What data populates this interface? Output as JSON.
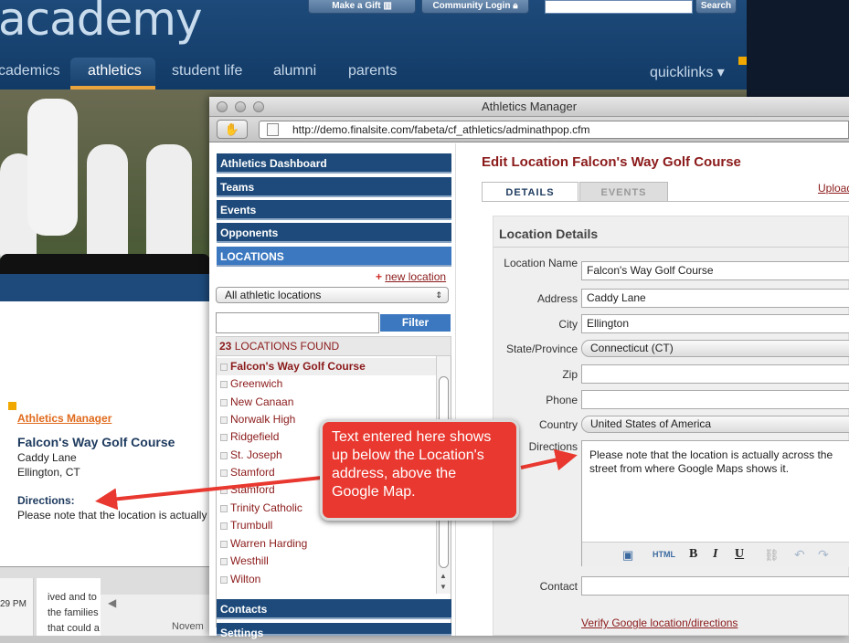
{
  "site": {
    "logo": "academy",
    "top_buttons": [
      "Make a Gift",
      "Community Login",
      "Search"
    ],
    "nav": [
      "cademics",
      "athletics",
      "student life",
      "alumni",
      "parents",
      "quicklinks ▾"
    ],
    "active_nav": "athletics",
    "content": {
      "manager_link": "Athletics Manager",
      "heading": "Falcon's Way Golf Course",
      "address1": "Caddy Lane",
      "address2": "Ellington, CT",
      "directions_label": "Directions:",
      "directions_text": "Please note that the location is actually"
    },
    "lower": {
      "time": "29 PM",
      "line1": "ived and to",
      "line2": "the families",
      "line3": "that could a",
      "month": "Novem"
    }
  },
  "window": {
    "title": "Athletics Manager",
    "url": "http://demo.finalsite.com/fabeta/cf_athletics/adminathpop.cfm"
  },
  "left": {
    "menu": [
      "Athletics Dashboard",
      "Teams",
      "Events",
      "Opponents",
      "LOCATIONS"
    ],
    "new_location": "new location",
    "filter_select": "All athletic locations",
    "filter_button": "Filter",
    "found_count": "23",
    "found_label": "LOCATIONS FOUND",
    "locations": [
      "Falcon's Way Golf Course",
      "Greenwich",
      "New Canaan",
      "Norwalk High",
      "Ridgefield",
      "St. Joseph",
      "Stamford",
      "Stamford",
      "Trinity Catholic",
      "Trumbull",
      "Warren Harding",
      "Westhill",
      "Wilton"
    ],
    "bottom_menu": [
      "Contacts",
      "Settings"
    ]
  },
  "right": {
    "heading": "Edit Location Falcon's Way Golf Course",
    "tabs": [
      "DETAILS",
      "EVENTS"
    ],
    "upload_link": "Upload",
    "section_title": "Location Details",
    "fields": {
      "name_label": "Location Name",
      "name_value": "Falcon's Way Golf Course",
      "address_label": "Address",
      "address_value": "Caddy Lane",
      "city_label": "City",
      "city_value": "Ellington",
      "state_label": "State/Province",
      "state_value": "Connecticut (CT)",
      "zip_label": "Zip",
      "zip_value": "",
      "phone_label": "Phone",
      "phone_value": "",
      "country_label": "Country",
      "country_value": "United States of America",
      "directions_label": "Directions",
      "directions_value": "Please note that the location is actually across the street from where Google Maps shows it.",
      "contact_label": "Contact",
      "contact_value": ""
    },
    "verify_link": "Verify Google location/directions"
  },
  "callout": {
    "text": "Text entered here shows up below the Location's address, above the Google Map."
  },
  "colors": {
    "navy": "#1d4a7a",
    "maroon": "#8b1a1a",
    "callout_red": "#e8382f",
    "orange": "#e06a1c"
  }
}
